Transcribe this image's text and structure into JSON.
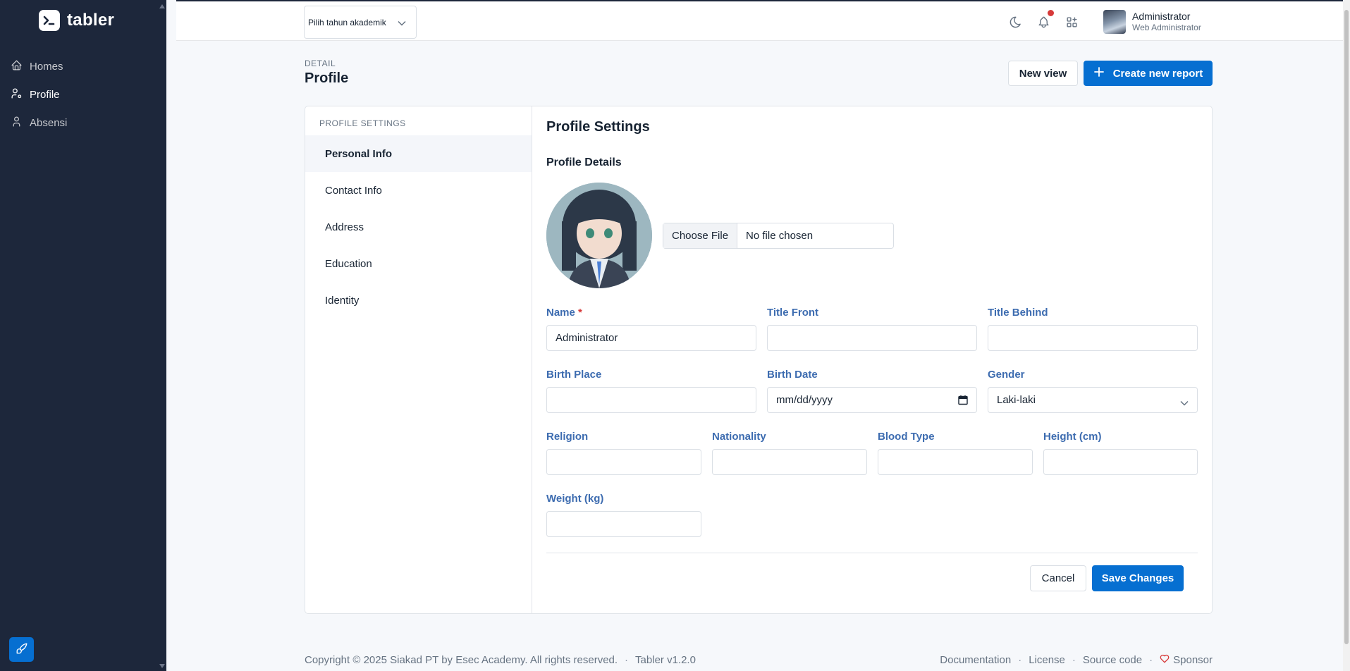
{
  "brand": {
    "name": "tabler"
  },
  "sidebar": {
    "items": [
      {
        "label": "Homes",
        "icon": "home-icon"
      },
      {
        "label": "Profile",
        "icon": "user-icon"
      },
      {
        "label": "Absensi",
        "icon": "user-icon"
      }
    ]
  },
  "topbar": {
    "year_select": "Pilih tahun akademik",
    "user_name": "Administrator",
    "user_role": "Web Administrator"
  },
  "header": {
    "pretitle": "DETAIL",
    "title": "Profile",
    "new_view_label": "New view",
    "create_report_label": "Create new report"
  },
  "settings_nav": {
    "subheader": "PROFILE SETTINGS",
    "items": [
      "Personal Info",
      "Contact Info",
      "Address",
      "Education",
      "Identity"
    ]
  },
  "form": {
    "title": "Profile Settings",
    "section": "Profile Details",
    "file_button": "Choose File",
    "file_status": "No file chosen",
    "name_label": "Name",
    "name_required": "*",
    "name_value": "Administrator",
    "title_front_label": "Title Front",
    "title_behind_label": "Title Behind",
    "birth_place_label": "Birth Place",
    "birth_date_label": "Birth Date",
    "birth_date_placeholder": "mm/dd/yyyy",
    "gender_label": "Gender",
    "gender_value": "Laki-laki",
    "religion_label": "Religion",
    "nationality_label": "Nationality",
    "blood_type_label": "Blood Type",
    "height_label": "Height (cm)",
    "weight_label": "Weight (kg)",
    "cancel_label": "Cancel",
    "save_label": "Save Changes"
  },
  "footer": {
    "copyright": "Copyright © 2025 Siakad PT by Esec Academy. All rights reserved.",
    "version": "Tabler v1.2.0",
    "links": [
      "Documentation",
      "License",
      "Source code",
      "Sponsor"
    ]
  },
  "colors": {
    "sidebar": "#1d273b",
    "primary": "#066fd1",
    "label": "#3d6cb0",
    "danger": "#d63939"
  }
}
